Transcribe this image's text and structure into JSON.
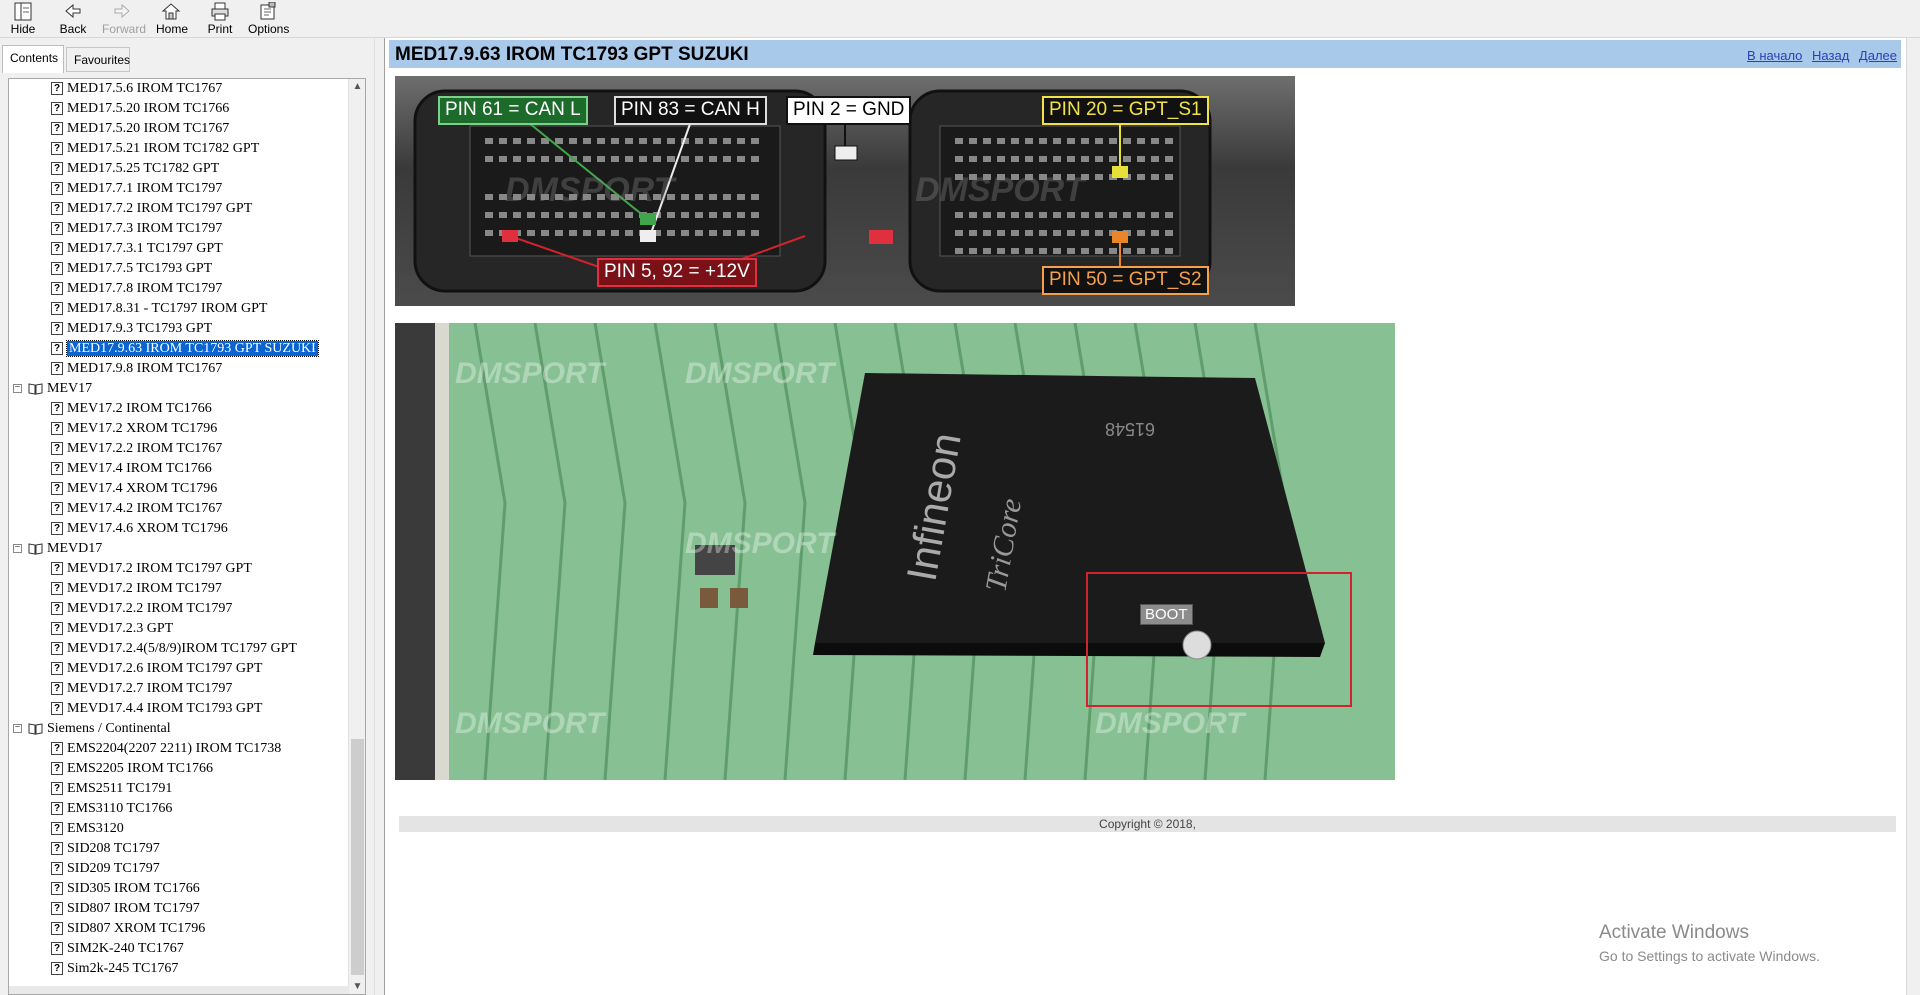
{
  "toolbar": {
    "hide": "Hide",
    "back": "Back",
    "forward": "Forward",
    "home": "Home",
    "print": "Print",
    "options": "Options"
  },
  "nav": {
    "tab_contents": "Contents",
    "tab_favourites": "Favourites",
    "items": [
      {
        "type": "topic",
        "label": "MED17.5.6 IROM TC1767"
      },
      {
        "type": "topic",
        "label": "MED17.5.20 IROM TC1766"
      },
      {
        "type": "topic",
        "label": "MED17.5.20 IROM TC1767"
      },
      {
        "type": "topic",
        "label": "MED17.5.21 IROM TC1782 GPT"
      },
      {
        "type": "topic",
        "label": "MED17.5.25 TC1782 GPT"
      },
      {
        "type": "topic",
        "label": "MED17.7.1 IROM TC1797"
      },
      {
        "type": "topic",
        "label": "MED17.7.2 IROM TC1797 GPT"
      },
      {
        "type": "topic",
        "label": "MED17.7.3 IROM TC1797"
      },
      {
        "type": "topic",
        "label": "MED17.7.3.1 TC1797 GPT"
      },
      {
        "type": "topic",
        "label": "MED17.7.5 TC1793 GPT"
      },
      {
        "type": "topic",
        "label": "MED17.7.8 IROM TC1797"
      },
      {
        "type": "topic",
        "label": "MED17.8.31 - TC1797 IROM GPT"
      },
      {
        "type": "topic",
        "label": "MED17.9.3 TC1793 GPT"
      },
      {
        "type": "topic",
        "label": "MED17.9.63 IROM TC1793 GPT SUZUKI",
        "selected": true
      },
      {
        "type": "topic",
        "label": "MED17.9.8 IROM TC1767"
      },
      {
        "type": "book",
        "label": "MEV17"
      },
      {
        "type": "topic",
        "label": "MEV17.2 IROM TC1766"
      },
      {
        "type": "topic",
        "label": "MEV17.2 XROM TC1796"
      },
      {
        "type": "topic",
        "label": "MEV17.2.2 IROM TC1767"
      },
      {
        "type": "topic",
        "label": "MEV17.4 IROM TC1766"
      },
      {
        "type": "topic",
        "label": "MEV17.4 XROM TC1796"
      },
      {
        "type": "topic",
        "label": "MEV17.4.2 IROM TC1767"
      },
      {
        "type": "topic",
        "label": "MEV17.4.6 XROM TC1796"
      },
      {
        "type": "book",
        "label": "MEVD17"
      },
      {
        "type": "topic",
        "label": "MEVD17.2  IROM TC1797 GPT"
      },
      {
        "type": "topic",
        "label": "MEVD17.2 IROM TC1797"
      },
      {
        "type": "topic",
        "label": "MEVD17.2.2 IROM TC1797"
      },
      {
        "type": "topic",
        "label": "MEVD17.2.3 GPT"
      },
      {
        "type": "topic",
        "label": "MEVD17.2.4(5/8/9)IROM TC1797 GPT"
      },
      {
        "type": "topic",
        "label": "MEVD17.2.6 IROM TC1797 GPT"
      },
      {
        "type": "topic",
        "label": "MEVD17.2.7 IROM TC1797"
      },
      {
        "type": "topic",
        "label": "MEVD17.4.4 IROM TC1793 GPT"
      },
      {
        "type": "book",
        "label": "Siemens / Continental"
      },
      {
        "type": "topic",
        "label": "EMS2204(2207 2211) IROM TC1738"
      },
      {
        "type": "topic",
        "label": "EMS2205 IROM TC1766"
      },
      {
        "type": "topic",
        "label": "EMS2511 TC1791"
      },
      {
        "type": "topic",
        "label": "EMS3110 TC1766"
      },
      {
        "type": "topic",
        "label": "EMS3120"
      },
      {
        "type": "topic",
        "label": "SID208 TC1797"
      },
      {
        "type": "topic",
        "label": "SID209 TC1797"
      },
      {
        "type": "topic",
        "label": "SID305 IROM TC1766"
      },
      {
        "type": "topic",
        "label": "SID807 IROM TC1797"
      },
      {
        "type": "topic",
        "label": "SID807 XROM TC1796"
      },
      {
        "type": "topic",
        "label": "SIM2K-240 TC1767"
      },
      {
        "type": "topic",
        "label": "Sim2k-245 TC1767"
      }
    ]
  },
  "page": {
    "title": "MED17.9.63 IROM TC1793 GPT SUZUKI",
    "link_home": "В начало",
    "link_back": "Назад",
    "link_next": "Далее",
    "copyright": "Copyright © 2018,"
  },
  "connector_image": {
    "labels": {
      "can_l": "PIN 61 = CAN L",
      "can_h": "PIN 83 = CAN H",
      "gnd": "PIN 2 = GND",
      "gpt_s1": "PIN 20 = GPT_S1",
      "gpt_s2": "PIN 50 = GPT_S2",
      "v12": "PIN 5, 92 = +12V"
    },
    "watermark": "DMSPORT"
  },
  "chip_image": {
    "boot_label": "BOOT",
    "chip_text_brand": "Infineon",
    "chip_text_line": "TriCore",
    "chip_text_code": "61548",
    "watermark": "DMSPORT"
  },
  "os_watermark": {
    "line1": "Activate Windows",
    "line2": "Go to Settings to activate Windows."
  },
  "colors": {
    "selection": "#0a64d2",
    "title_bar": "#a9c9ea",
    "link": "#2a3fb8"
  }
}
